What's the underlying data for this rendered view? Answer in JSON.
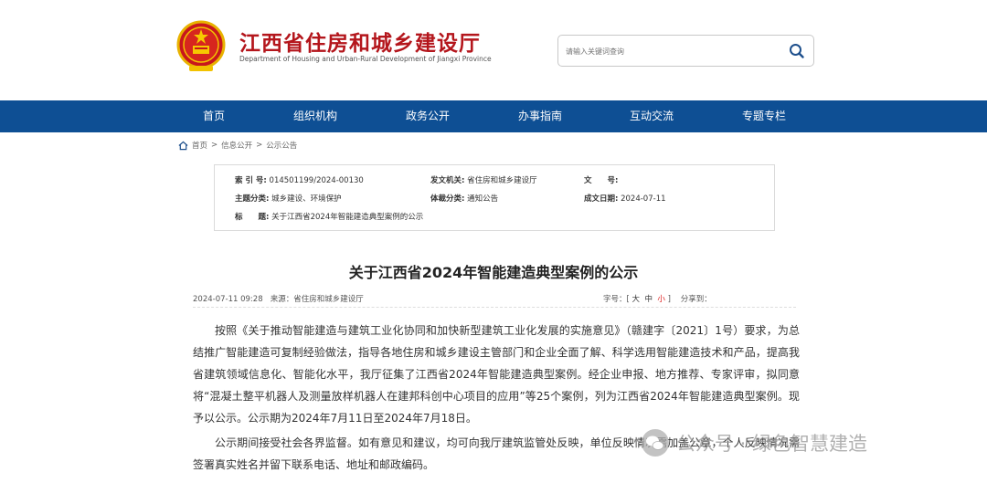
{
  "header": {
    "title": "江西省住房和城乡建设厅",
    "subtitle": "Department of Housing and Urban-Rural Development of Jiangxi Province",
    "search_placeholder": "请输入关键词查询"
  },
  "nav": [
    "首页",
    "组织机构",
    "政务公开",
    "办事指南",
    "互动交流",
    "专题专栏"
  ],
  "breadcrumb": [
    "首页",
    ">",
    "信息公开",
    ">",
    "公示公告"
  ],
  "meta": {
    "index_label": "索 引 号:",
    "index_value": "014501199/2024-00130",
    "issuer_label": "发文机关:",
    "issuer_value": "省住房和城乡建设厅",
    "doc_no_label": "文　　号:",
    "doc_no_value": "",
    "topic_label": "主题分类:",
    "topic_value": "城乡建设、环境保护",
    "genre_label": "体裁分类:",
    "genre_value": "通知公告",
    "date_label": "成文日期:",
    "date_value": "2024-07-11",
    "title_label": "标　　题:",
    "title_value": "关于江西省2024年智能建造典型案例的公示"
  },
  "article": {
    "title": "关于江西省2024年智能建造典型案例的公示",
    "date": "2024-07-11 09:28",
    "source_label": "来源：",
    "source": "省住房和城乡建设厅",
    "fontsize_label": "字号：[",
    "fs_large": "大",
    "fs_mid": "中",
    "fs_small": "小",
    "fs_close": "]",
    "share_label": "分享到：",
    "p1": "按照《关于推动智能建造与建筑工业化协同和加快新型建筑工业化发展的实施意见》（赣建字〔2021〕1号）要求，为总结推广智能建造可复制经验做法，指导各地住房和城乡建设主管部门和企业全面了解、科学选用智能建造技术和产品，提高我省建筑领域信息化、智能化水平，我厅征集了江西省2024年智能建造典型案例。经企业申报、地方推荐、专家评审，拟同意将“混凝土整平机器人及测量放样机器人在建邦科创中心项目的应用”等25个案例，列为江西省2024年智能建造典型案例。现予以公示。公示期为2024年7月11日至2024年7月18日。",
    "p2": "公示期间接受社会各界监督。如有意见和建议，均可向我厅建筑监管处反映，单位反映情况需加盖公章，个人反映情况需签署真实姓名并留下联系电话、地址和邮政编码。"
  },
  "watermark": "公众号 · 绿色智慧建造",
  "colors": {
    "brand_red": "#b4161c",
    "nav_blue": "#0e4f94"
  }
}
